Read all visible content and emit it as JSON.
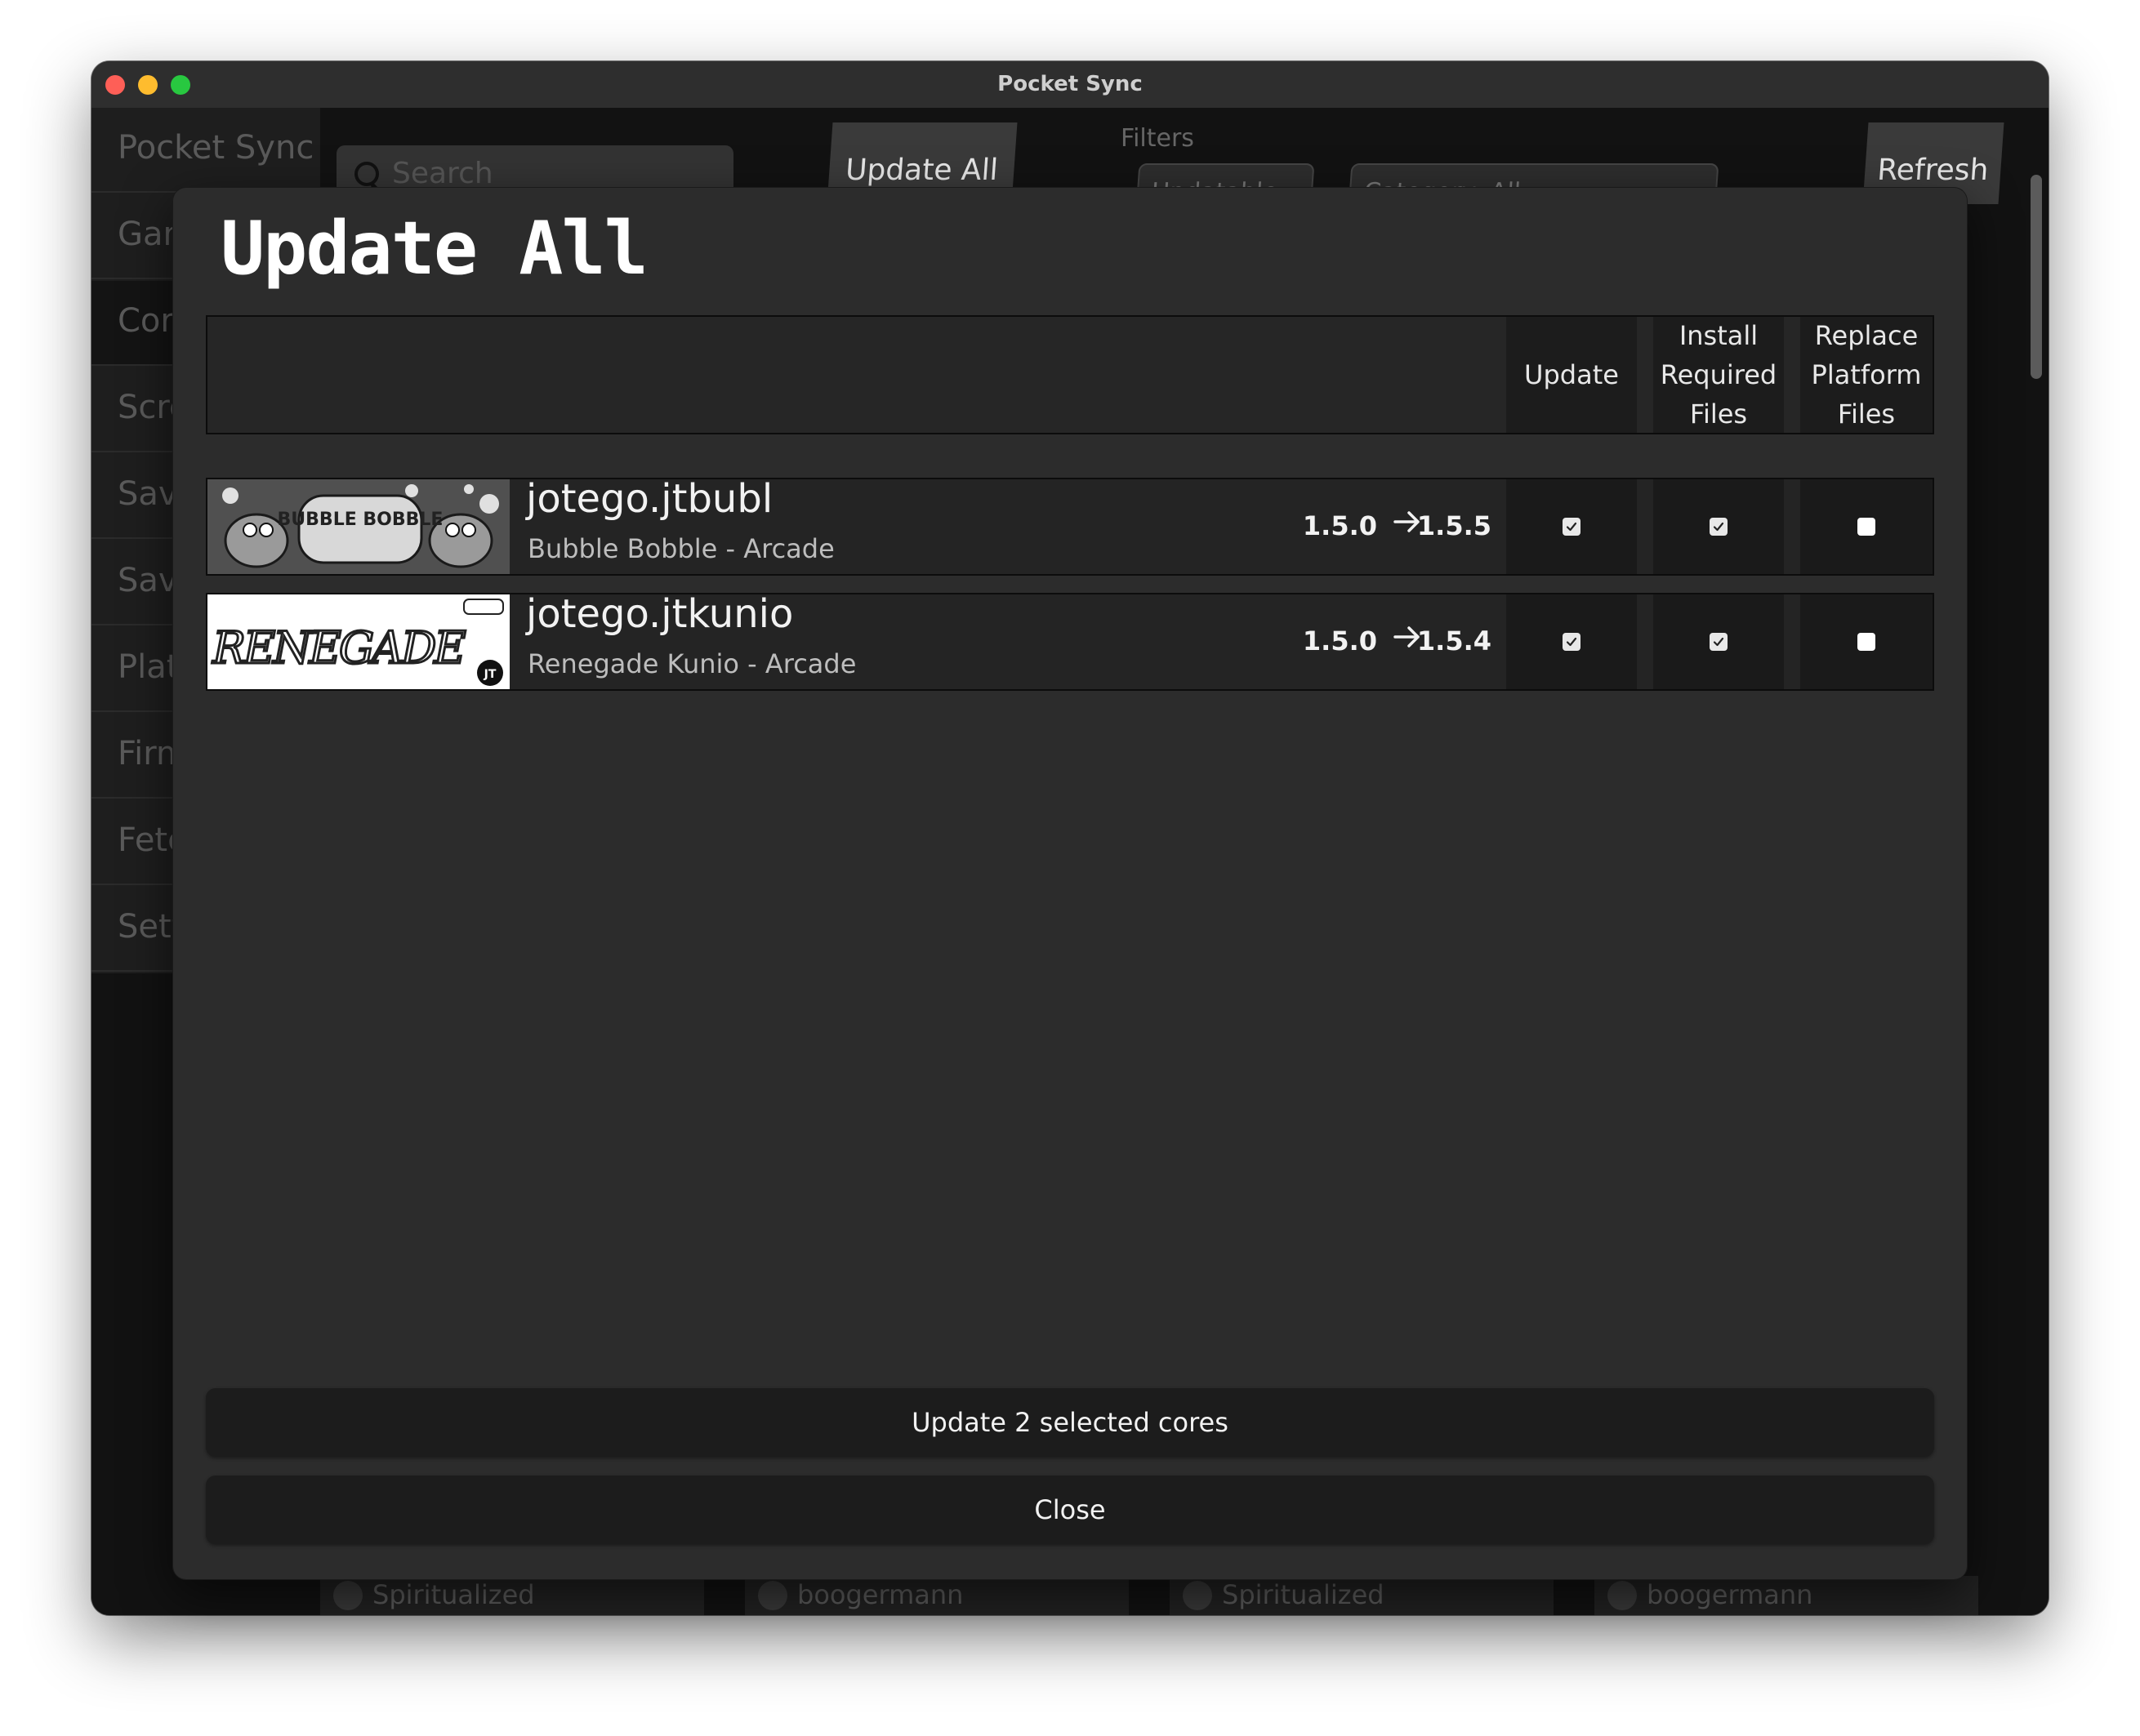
{
  "window": {
    "title": "Pocket Sync"
  },
  "sidebar": {
    "items": [
      {
        "label": "Pocket Sync"
      },
      {
        "label": "Games"
      },
      {
        "label": "Cores"
      },
      {
        "label": "Screenshots"
      },
      {
        "label": "Saves"
      },
      {
        "label": "Save States"
      },
      {
        "label": "Platforms"
      },
      {
        "label": "Firmware"
      },
      {
        "label": "Fetch"
      },
      {
        "label": "Settings"
      }
    ]
  },
  "toolbar": {
    "search_placeholder": "Search",
    "update_all_label": "Update All",
    "filters_label": "Filters",
    "updatable_label": "Updatable",
    "category_label": "Category: All",
    "refresh_label": "Refresh"
  },
  "bg_list": {
    "authors": [
      "Spiritualized",
      "boogermann",
      "Spiritualized",
      "boogermann"
    ]
  },
  "modal": {
    "title": "Update All",
    "columns": {
      "update": "Update",
      "install_required": [
        "Install",
        "Required",
        "Files"
      ],
      "replace_platform": [
        "Replace",
        "Platform",
        "Files"
      ]
    },
    "cores": [
      {
        "id": "jotego.jtbubl",
        "description": "Bubble Bobble - Arcade",
        "from_version": "1.5.0",
        "to_version": "1.5.5",
        "update": true,
        "install_required_files": true,
        "replace_platform_files": false,
        "thumb_text": "BUBBLE BOBBLE"
      },
      {
        "id": "jotego.jtkunio",
        "description": "Renegade Kunio - Arcade",
        "from_version": "1.5.0",
        "to_version": "1.5.4",
        "update": true,
        "install_required_files": true,
        "replace_platform_files": false,
        "thumb_text": "RENEGADE"
      }
    ],
    "update_button_label": "Update 2 selected cores",
    "close_button_label": "Close"
  }
}
